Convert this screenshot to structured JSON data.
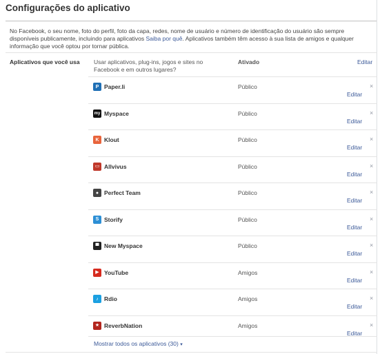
{
  "page": {
    "title": "Configurações do aplicativo"
  },
  "intro": {
    "text": "No Facebook, o seu nome, foto do perfil, foto da capa, redes, nome de usuário e número de identificação do usuário são sempre disponíveis publicamente, incluindo para aplicativos ",
    "link": "Saiba por quê",
    "text_after": ". Aplicativos também têm acesso à sua lista de amigos e qualquer informação que você optou por tornar pública."
  },
  "section": {
    "label": "Aplicativos que você usa",
    "description": "Usar aplicativos, plug-ins, jogos e sites no Facebook e em outros lugares?",
    "status": "Ativado",
    "edit": "Editar"
  },
  "apps": [
    {
      "name": "Paper.li",
      "status": "Público",
      "edit": "Editar",
      "remove": "×",
      "icon": "paperli-icon",
      "icon_glyph": "P",
      "color": "#1f6fb5"
    },
    {
      "name": "Myspace",
      "status": "Público",
      "edit": "Editar",
      "remove": "×",
      "icon": "myspace-icon",
      "icon_glyph": "my",
      "color": "#111111"
    },
    {
      "name": "Klout",
      "status": "Público",
      "edit": "Editar",
      "remove": "×",
      "icon": "klout-icon",
      "icon_glyph": "K",
      "color": "#e8643c"
    },
    {
      "name": "Allvivus",
      "status": "Público",
      "edit": "Editar",
      "remove": "×",
      "icon": "allvivus-icon",
      "icon_glyph": "▭",
      "color": "#c0392b"
    },
    {
      "name": "Perfect Team",
      "status": "Público",
      "edit": "Editar",
      "remove": "×",
      "icon": "soccer-ball-icon",
      "icon_glyph": "●",
      "color": "#444444"
    },
    {
      "name": "Storify",
      "status": "Público",
      "edit": "Editar",
      "remove": "×",
      "icon": "storify-icon",
      "icon_glyph": "S",
      "color": "#2d8fd5"
    },
    {
      "name": "New Myspace",
      "status": "Público",
      "edit": "Editar",
      "remove": "×",
      "icon": "new-myspace-icon",
      "icon_glyph": "▀",
      "color": "#222222"
    },
    {
      "name": "YouTube",
      "status": "Amigos",
      "edit": "Editar",
      "remove": "×",
      "icon": "youtube-icon",
      "icon_glyph": "▶",
      "color": "#d62b1f"
    },
    {
      "name": "Rdio",
      "status": "Amigos",
      "edit": "Editar",
      "remove": "×",
      "icon": "rdio-icon",
      "icon_glyph": "♪",
      "color": "#1ba0e1"
    },
    {
      "name": "ReverbNation",
      "status": "Amigos",
      "edit": "Editar",
      "remove": "×",
      "icon": "reverbnation-icon",
      "icon_glyph": "★",
      "color": "#b3261e"
    }
  ],
  "show_all": {
    "label": "Mostrar todos os aplicativos (30)",
    "caret": "▾"
  }
}
